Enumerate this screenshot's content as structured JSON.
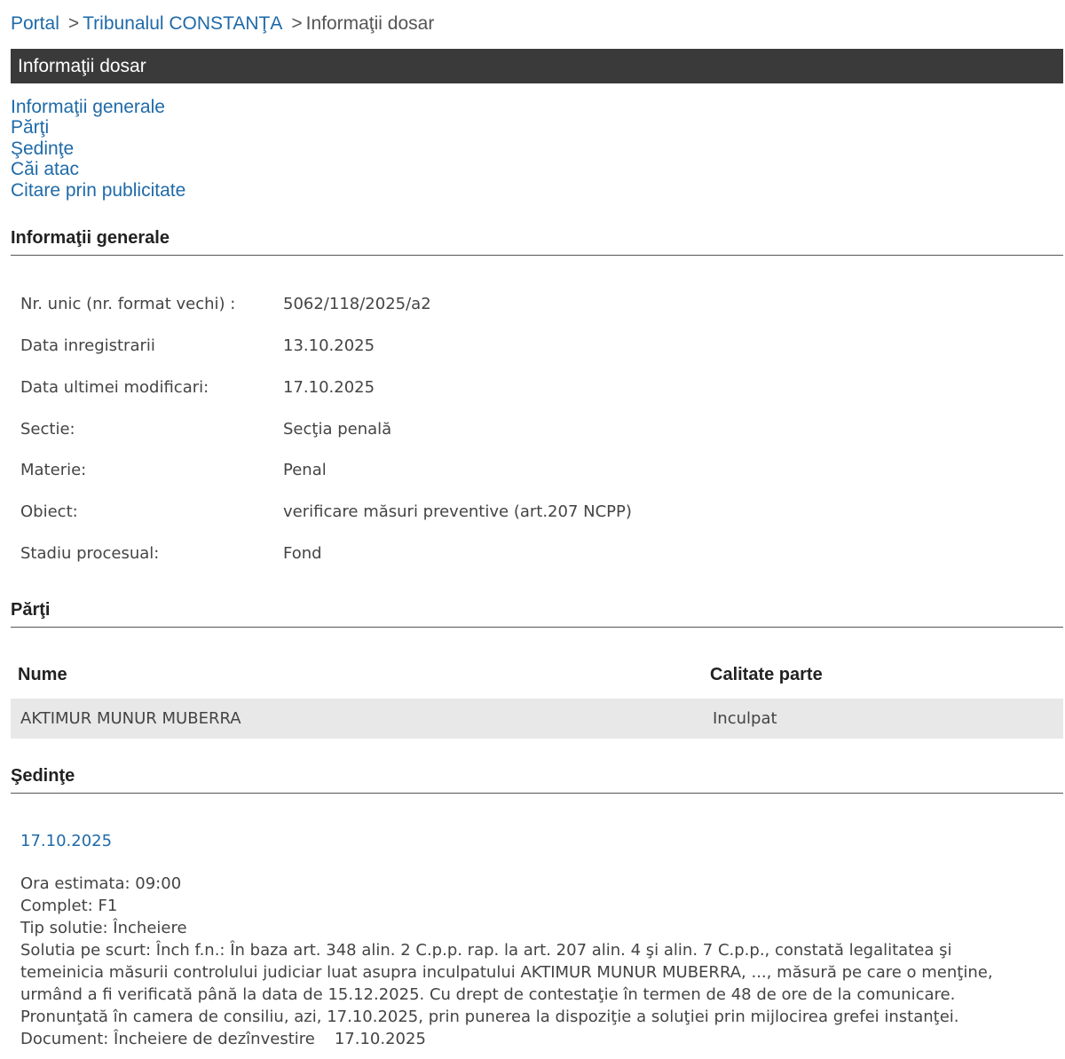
{
  "breadcrumb": {
    "items": [
      "Portal",
      "Tribunalul CONSTANŢA",
      "Informaţii dosar"
    ],
    "separator": ">"
  },
  "title_bar": {
    "label": "Informaţii dosar"
  },
  "nav": {
    "links": [
      "Informaţii generale",
      "Părţi",
      "Şedinţe",
      "Căi atac",
      "Citare prin publicitate"
    ]
  },
  "general": {
    "heading": "Informaţii generale",
    "fields": [
      {
        "label": "Nr. unic (nr. format vechi) :",
        "value": "5062/118/2025/a2"
      },
      {
        "label": "Data inregistrarii",
        "value": "13.10.2025"
      },
      {
        "label": "Data ultimei modificari:",
        "value": "17.10.2025"
      },
      {
        "label": "Sectie:",
        "value": "Secţia penală"
      },
      {
        "label": "Materie:",
        "value": "Penal"
      },
      {
        "label": "Obiect:",
        "value": "verificare măsuri preventive (art.207 NCPP)"
      },
      {
        "label": "Stadiu procesual:",
        "value": "Fond"
      }
    ]
  },
  "parties": {
    "heading": "Părţi",
    "columns": [
      "Nume",
      "Calitate parte"
    ],
    "rows": [
      {
        "name": "AKTIMUR MUNUR MUBERRA",
        "role": "Inculpat"
      }
    ]
  },
  "sessions": {
    "heading": "Şedinţe",
    "items": [
      {
        "date": "17.10.2025",
        "ora": "Ora estimata: 09:00",
        "complet": "Complet: F1",
        "tip": "Tip solutie: Încheiere",
        "solutie_lines": [
          "Solutia pe scurt: Înch f.n.: În baza art. 348 alin. 2 C.p.p. rap. la art. 207 alin. 4 şi alin. 7 C.p.p., constată legalitatea şi",
          "temeinicia măsurii controlului judiciar luat asupra inculpatului AKTIMUR MUNUR MUBERRA, ..., măsură pe care o menţine,",
          "urmând a fi verificată până la data de 15.12.2025. Cu drept de contestaţie în termen de 48 de ore de la comunicare.",
          "Pronunţată în camera de consiliu, azi, 17.10.2025, prin punerea la dispoziţie a soluţiei prin mijlocirea grefei instanţei."
        ],
        "document": "Document: Încheiere de dezînvestire",
        "document_date": "17.10.2025"
      }
    ]
  },
  "colors": {
    "link": "#1f6aa8",
    "title_bar_bg": "#3a3a3a",
    "row_bg": "#e8e8e8"
  }
}
